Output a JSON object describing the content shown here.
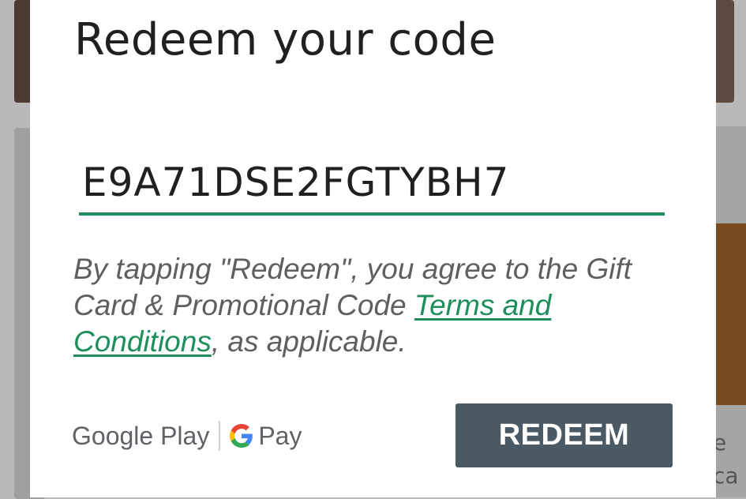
{
  "dialog": {
    "title": "Redeem your code",
    "code_value": "E9A71DSE2FGTYBH7",
    "terms_before": "By tapping \"Redeem\", you agree to the Gift Card & Promotional Code ",
    "terms_link": "Terms and Conditions",
    "terms_after": ", as applicable.",
    "brand_google_play": "Google Play",
    "brand_pay": "Pay",
    "redeem_label": "REDEEM"
  },
  "background": {
    "right_text": "e\nca"
  },
  "colors": {
    "accent": "#1e8f5a",
    "button": "#4a5963"
  },
  "icons": {
    "g_logo": "google-g-icon"
  }
}
